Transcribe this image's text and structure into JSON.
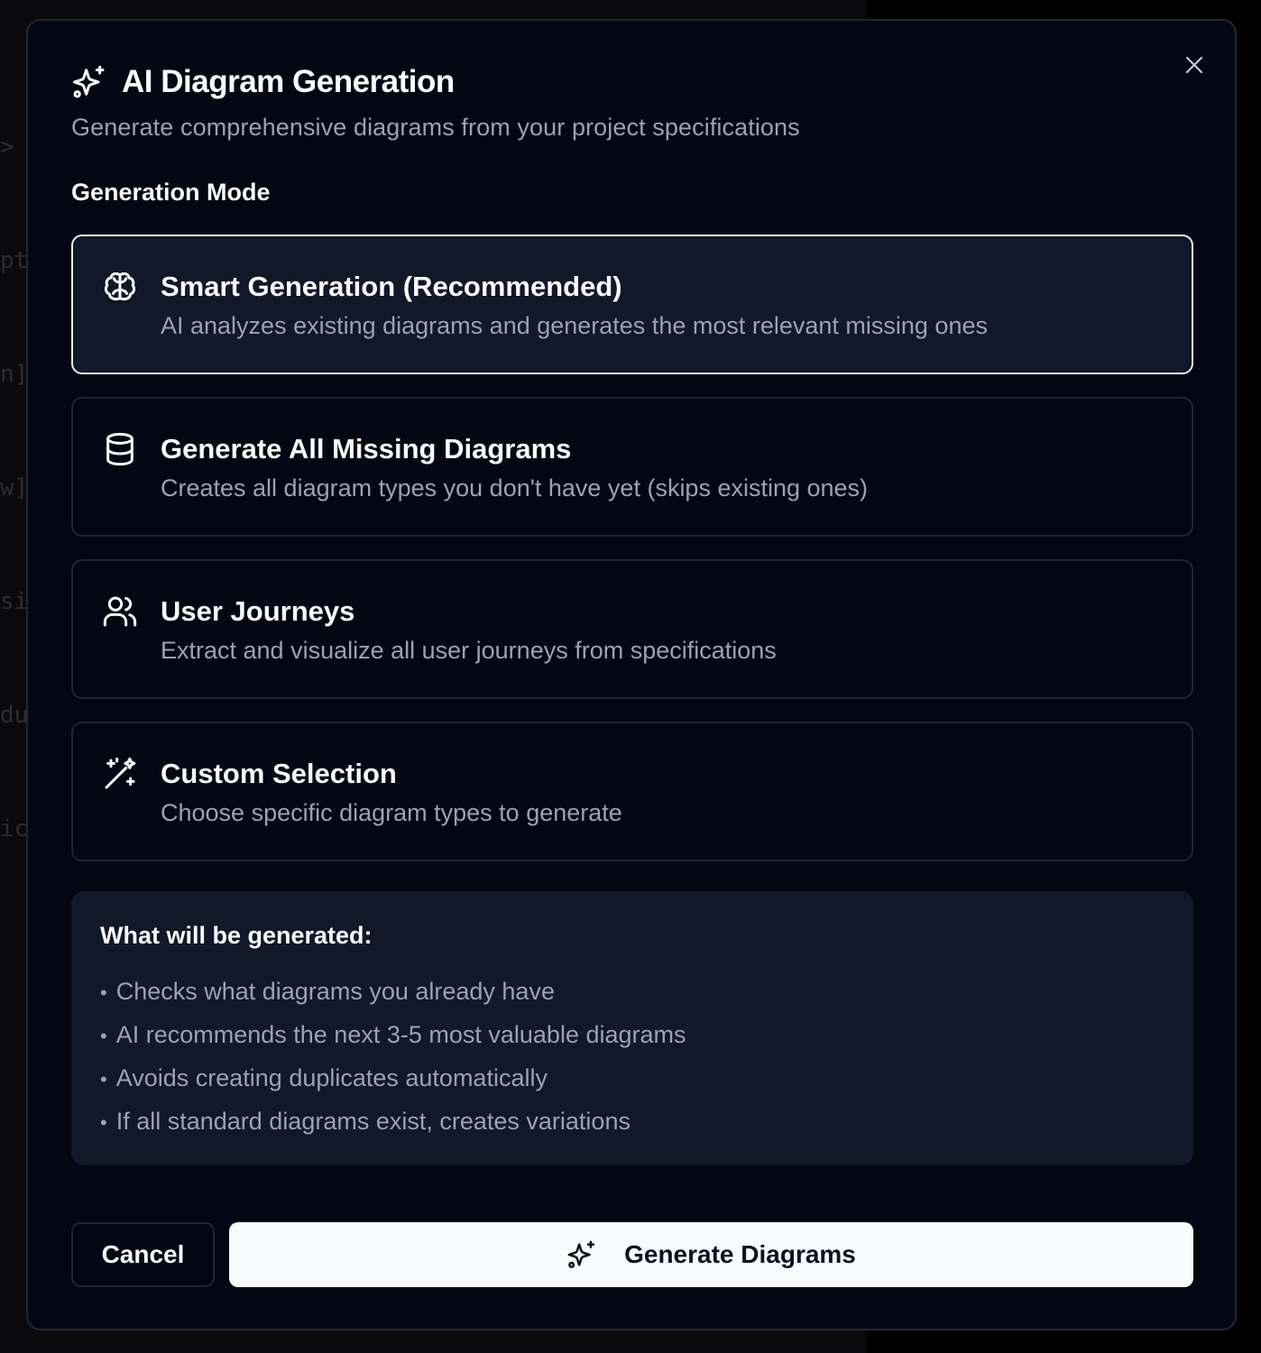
{
  "backdrop": {
    "code_fragments": [
      ">",
      "pt",
      "n]",
      "w]",
      "si",
      "du",
      "ic"
    ]
  },
  "dialog": {
    "title": "AI Diagram Generation",
    "subtitle": "Generate comprehensive diagrams from your project specifications",
    "title_icon": "sparkles-icon",
    "close_icon": "close-icon"
  },
  "generation_mode": {
    "label": "Generation Mode",
    "selected_index": 0,
    "options": [
      {
        "icon": "brain-icon",
        "title": "Smart Generation (Recommended)",
        "description": "AI analyzes existing diagrams and generates the most relevant missing ones"
      },
      {
        "icon": "database-icon",
        "title": "Generate All Missing Diagrams",
        "description": "Creates all diagram types you don't have yet (skips existing ones)"
      },
      {
        "icon": "users-icon",
        "title": "User Journeys",
        "description": "Extract and visualize all user journeys from specifications"
      },
      {
        "icon": "magic-wand-icon",
        "title": "Custom Selection",
        "description": "Choose specific diagram types to generate"
      }
    ]
  },
  "info": {
    "title": "What will be generated:",
    "items": [
      "Checks what diagrams you already have",
      "AI recommends the next 3-5 most valuable diagrams",
      "Avoids creating duplicates automatically",
      "If all standard diagrams exist, creates variations"
    ]
  },
  "footer": {
    "cancel_label": "Cancel",
    "generate_label": "Generate Diagrams",
    "generate_icon": "sparkles-icon"
  },
  "colors": {
    "dialog_bg": "#030712",
    "selected_bg": "#111827",
    "border": "#1f2733",
    "muted_text": "#99a3b3",
    "primary_button_bg": "#f8fafc"
  }
}
